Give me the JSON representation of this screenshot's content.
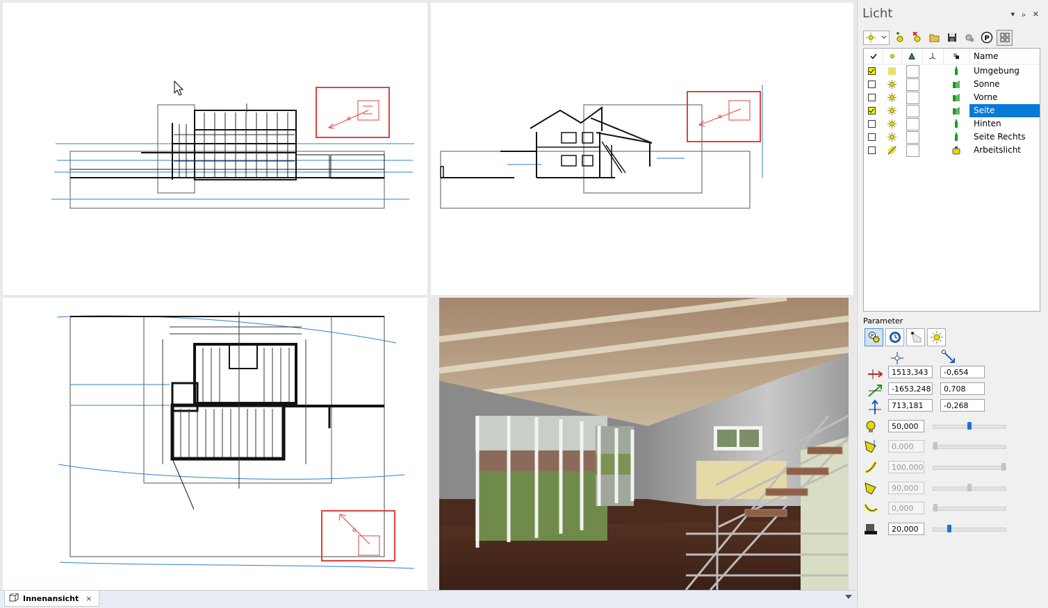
{
  "panel": {
    "title": "Licht",
    "controls": {
      "pin": "▾",
      "autohide": "⭟",
      "close": "✕"
    },
    "columns": {
      "name": "Name"
    },
    "lights": [
      {
        "name": "Umgebung",
        "checked": true,
        "selected": false,
        "bulb": "ambient",
        "lamp": "green"
      },
      {
        "name": "Sonne",
        "checked": false,
        "selected": false,
        "bulb": "sun",
        "lamp": "green-dir"
      },
      {
        "name": "Vorne",
        "checked": false,
        "selected": false,
        "bulb": "sun",
        "lamp": "green-dir"
      },
      {
        "name": "Seite",
        "checked": true,
        "selected": true,
        "bulb": "sun",
        "lamp": "green-dir"
      },
      {
        "name": "Hinten",
        "checked": false,
        "selected": false,
        "bulb": "sun",
        "lamp": "green"
      },
      {
        "name": "Seite Rechts",
        "checked": false,
        "selected": false,
        "bulb": "sun",
        "lamp": "green"
      },
      {
        "name": "Arbeitslicht",
        "checked": false,
        "selected": false,
        "bulb": "spot",
        "lamp": "yellow"
      }
    ],
    "parameter_label": "Parameter",
    "position": {
      "x": "1513,343",
      "y": "-1653,248",
      "z": "713,181"
    },
    "direction": {
      "x": "-0,654",
      "y": "0,708",
      "z": "-0,268"
    },
    "params": [
      {
        "value": "50,000",
        "enabled": true,
        "level": 0.5
      },
      {
        "value": "0,000",
        "enabled": false,
        "level": 0.0
      },
      {
        "value": "100,000",
        "enabled": false,
        "level": 1.0
      },
      {
        "value": "90,000",
        "enabled": false,
        "level": 0.5
      },
      {
        "value": "0,000",
        "enabled": false,
        "level": 0.0
      },
      {
        "value": "20,000",
        "enabled": true,
        "level": 0.2
      }
    ]
  },
  "tabbar": {
    "tab_label": "Innenansicht",
    "close": "×"
  },
  "colors": {
    "accent": "#0a7ad7",
    "highlight_box": "#e0403a",
    "blue_lines": "#2a7fd0"
  }
}
